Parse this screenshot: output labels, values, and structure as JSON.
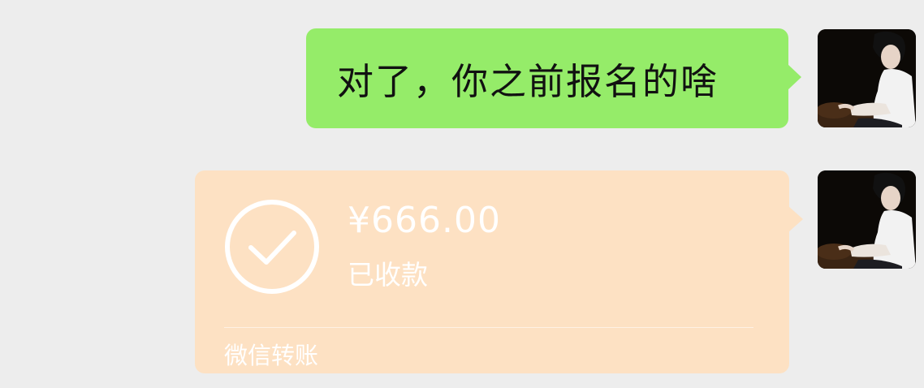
{
  "messages": {
    "text_message": {
      "text": "对了，你之前报名的啥",
      "bubble_color": "#95ec69"
    },
    "transfer": {
      "amount": "¥666.00",
      "status": "已收款",
      "footer": "微信转账",
      "card_color": "#fde1c3",
      "icon": "check-circle-icon"
    }
  },
  "colors": {
    "background": "#ededed"
  }
}
